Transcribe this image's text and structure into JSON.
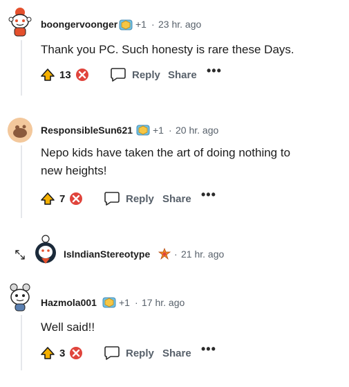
{
  "comments": [
    {
      "author": "boongervoonger",
      "flair_extra": "+1",
      "separator": "·",
      "time": "23 hr. ago",
      "body": "Thank you PC. Such honesty is rare these Days.",
      "score": "13",
      "reply_label": "Reply",
      "share_label": "Share",
      "more_label": "•••"
    },
    {
      "author": "ResponsibleSun621",
      "flair_extra": "+1",
      "separator": "·",
      "time": "20 hr. ago",
      "body": "Nepo kids have taken the art of doing nothing to new heights!",
      "score": "7",
      "reply_label": "Reply",
      "share_label": "Share",
      "more_label": "•••"
    },
    {
      "author": "IsIndianStereotype",
      "separator": "·",
      "time": "21 hr. ago",
      "collapsed": true
    },
    {
      "author": "Hazmola001",
      "flair_extra": "+1",
      "separator": "·",
      "time": "17 hr. ago",
      "body": "Well said!!",
      "score": "3",
      "reply_label": "Reply",
      "share_label": "Share",
      "more_label": "•••"
    }
  ],
  "icons": {
    "upvote": "upvote-arrow-icon",
    "downvote": "downvote-circle-icon",
    "reply": "speech-bubble-icon",
    "expand": "expand-arrows-icon",
    "flair": "flair-badge-icon"
  },
  "colors": {
    "upvote": "#f5b000",
    "downvote": "#e0443c",
    "meta": "#57606a",
    "thread_line": "#e5e7eb"
  }
}
